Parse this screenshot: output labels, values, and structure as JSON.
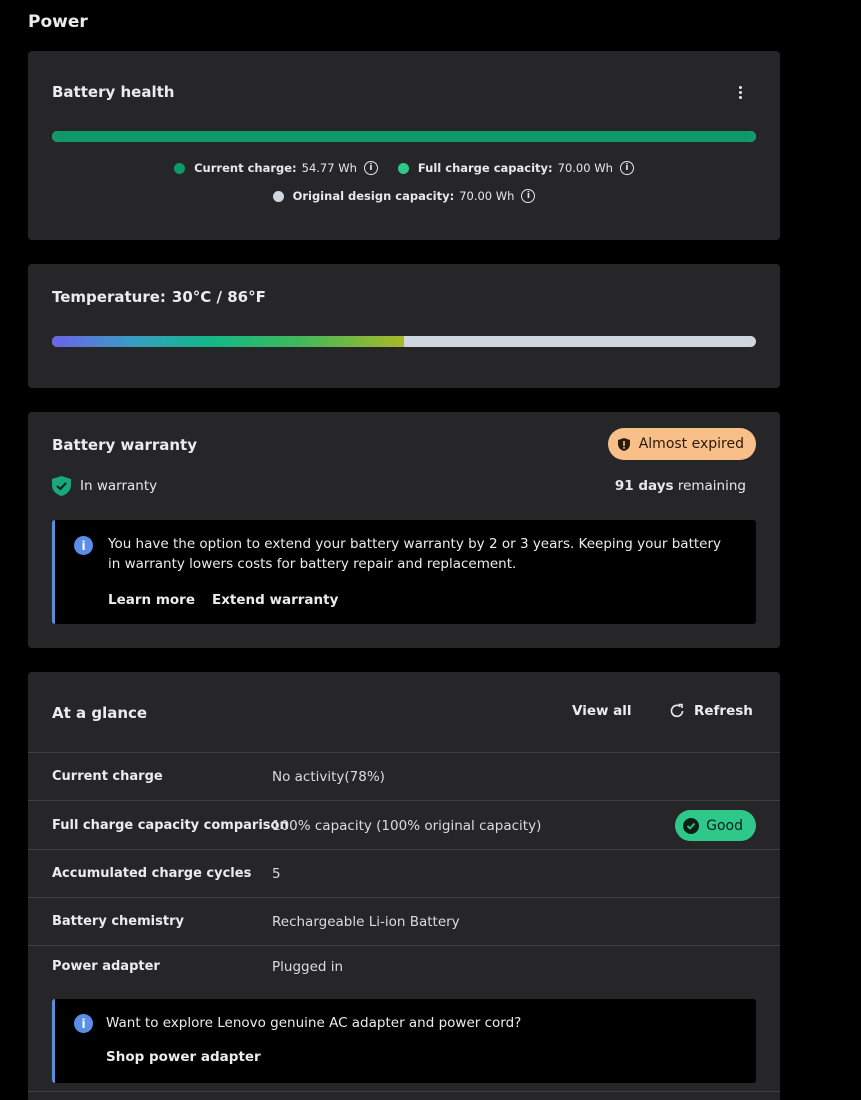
{
  "page": {
    "title": "Power"
  },
  "health": {
    "title": "Battery health",
    "fill_fraction": 1.0,
    "current_charge_label": "Current charge:",
    "current_charge_value": "54.77 Wh",
    "full_capacity_label": "Full charge capacity:",
    "full_capacity_value": "70.00 Wh",
    "design_capacity_label": "Original design capacity:",
    "design_capacity_value": "70.00 Wh",
    "colors": {
      "current": "#0f9868",
      "full": "#2ec98a",
      "design": "#d0d6de"
    }
  },
  "temperature": {
    "label": "Temperature:",
    "value": "30°C / 86°F",
    "fill_fraction": 0.5
  },
  "warranty": {
    "title": "Battery warranty",
    "badge": "Almost expired",
    "status": "In warranty",
    "days": "91 days",
    "remaining": "remaining",
    "notice_text": "You have the option to extend your battery warranty by 2 or 3 years. Keeping your battery in warranty lowers costs for battery repair and replacement.",
    "learn_more": "Learn more",
    "extend": "Extend warranty"
  },
  "glance": {
    "title": "At a glance",
    "view_all": "View all",
    "refresh": "Refresh",
    "rows": [
      {
        "label": "Current charge",
        "value": "No activity(78%)"
      },
      {
        "label": "Full charge capacity comparison",
        "value": "100% capacity (100% original capacity)",
        "badge": "Good"
      },
      {
        "label": "Accumulated charge cycles",
        "value": "5"
      },
      {
        "label": "Battery chemistry",
        "value": "Rechargeable Li-ion Battery"
      },
      {
        "label": "Power adapter",
        "value": "Plugged in"
      }
    ],
    "adapter_notice": "Want to explore Lenovo genuine AC adapter and power cord?",
    "shop": "Shop power adapter"
  },
  "icons": {
    "info": "i",
    "kebab": "more-vertical-icon",
    "shield": "shield-check-icon",
    "refresh": "refresh-icon"
  }
}
